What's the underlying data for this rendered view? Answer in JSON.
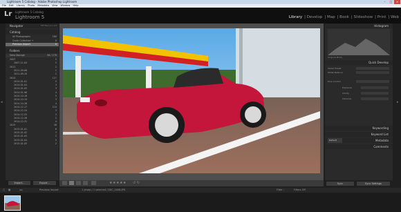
{
  "window": {
    "title": "Lightroom 5 Catalog - Adobe Photoshop Lightroom"
  },
  "menu": [
    "File",
    "Edit",
    "Library",
    "Photo",
    "Metadata",
    "View",
    "Window",
    "Help"
  ],
  "identity": {
    "logo": "Lr",
    "catalog": "Lightroom 5 Catalog",
    "product": "Lightroom 5"
  },
  "modules": [
    "Library",
    "Develop",
    "Map",
    "Book",
    "Slideshow",
    "Print",
    "Web"
  ],
  "left_panel": {
    "navigator": {
      "title": "Navigator",
      "zoom": "FIT  FILL  1:1  1:4"
    },
    "catalog": {
      "title": "Catalog",
      "items": [
        {
          "label": "All Photographs",
          "count": "180"
        },
        {
          "label": "Quick Collection +",
          "count": "0"
        },
        {
          "label": "Previous Import",
          "count": "0"
        }
      ]
    },
    "folders": {
      "title": "Folders",
      "drive": "Data Storage",
      "drive_info": "96 / 1TB",
      "items": [
        {
          "label": "2007",
          "count": "5"
        },
        {
          "label": "2007-11-04",
          "count": "5"
        },
        {
          "label": "2011",
          "count": "2"
        },
        {
          "label": "2011-09-06",
          "count": "1"
        },
        {
          "label": "2011-09-10",
          "count": "1"
        },
        {
          "label": "2014",
          "count": "127"
        },
        {
          "label": "2014-01-01",
          "count": "5"
        },
        {
          "label": "2014-01-04",
          "count": "3"
        },
        {
          "label": "2014-01-05",
          "count": "3"
        },
        {
          "label": "2014-01-06",
          "count": "4"
        },
        {
          "label": "2014-10-18",
          "count": "5"
        },
        {
          "label": "2014-10-19",
          "count": "3"
        },
        {
          "label": "2014-10-26",
          "count": "4"
        },
        {
          "label": "2014-12-17",
          "count": "110"
        },
        {
          "label": "2014-12-24",
          "count": "3"
        },
        {
          "label": "2014-12-25",
          "count": "3"
        },
        {
          "label": "2014-12-26",
          "count": "2"
        },
        {
          "label": "2014-12-31",
          "count": "4"
        },
        {
          "label": "2015",
          "count": "48"
        },
        {
          "label": "2015-01-01",
          "count": "6"
        },
        {
          "label": "2015-01-02",
          "count": "3"
        },
        {
          "label": "2015-01-03",
          "count": "2"
        },
        {
          "label": "2015-01-04",
          "count": "5"
        },
        {
          "label": "2015-01-05",
          "count": "2"
        }
      ]
    }
  },
  "left_buttons": {
    "import": "Import...",
    "export": "Export..."
  },
  "right_panel": {
    "histogram": "Histogram",
    "quick_develop": "Quick Develop",
    "saved_preset": "Saved Preset",
    "white_balance": "White Balance",
    "tone_control": "Tone Control",
    "auto_tone": "Auto Tone",
    "sliders": [
      "Exposure",
      "Clarity",
      "Vibrance"
    ],
    "keywording": "Keywording",
    "keyword_list": "Keyword List",
    "metadata": "Metadata",
    "metadata_preset": "Default",
    "comments": "Comments",
    "original_photo": "Original Photo",
    "sync": "Sync",
    "sync_settings": "Sync Settings"
  },
  "filmbar": {
    "source": "Previous Import",
    "info": "1 photo / 1 selected / DSC_0008.JPG",
    "filter": "Filter :",
    "filter_value": "Filters Off"
  },
  "colors": {
    "accent": "#f0f0f0",
    "panel": "#2a2a2a",
    "car_red": "#c4163a"
  }
}
